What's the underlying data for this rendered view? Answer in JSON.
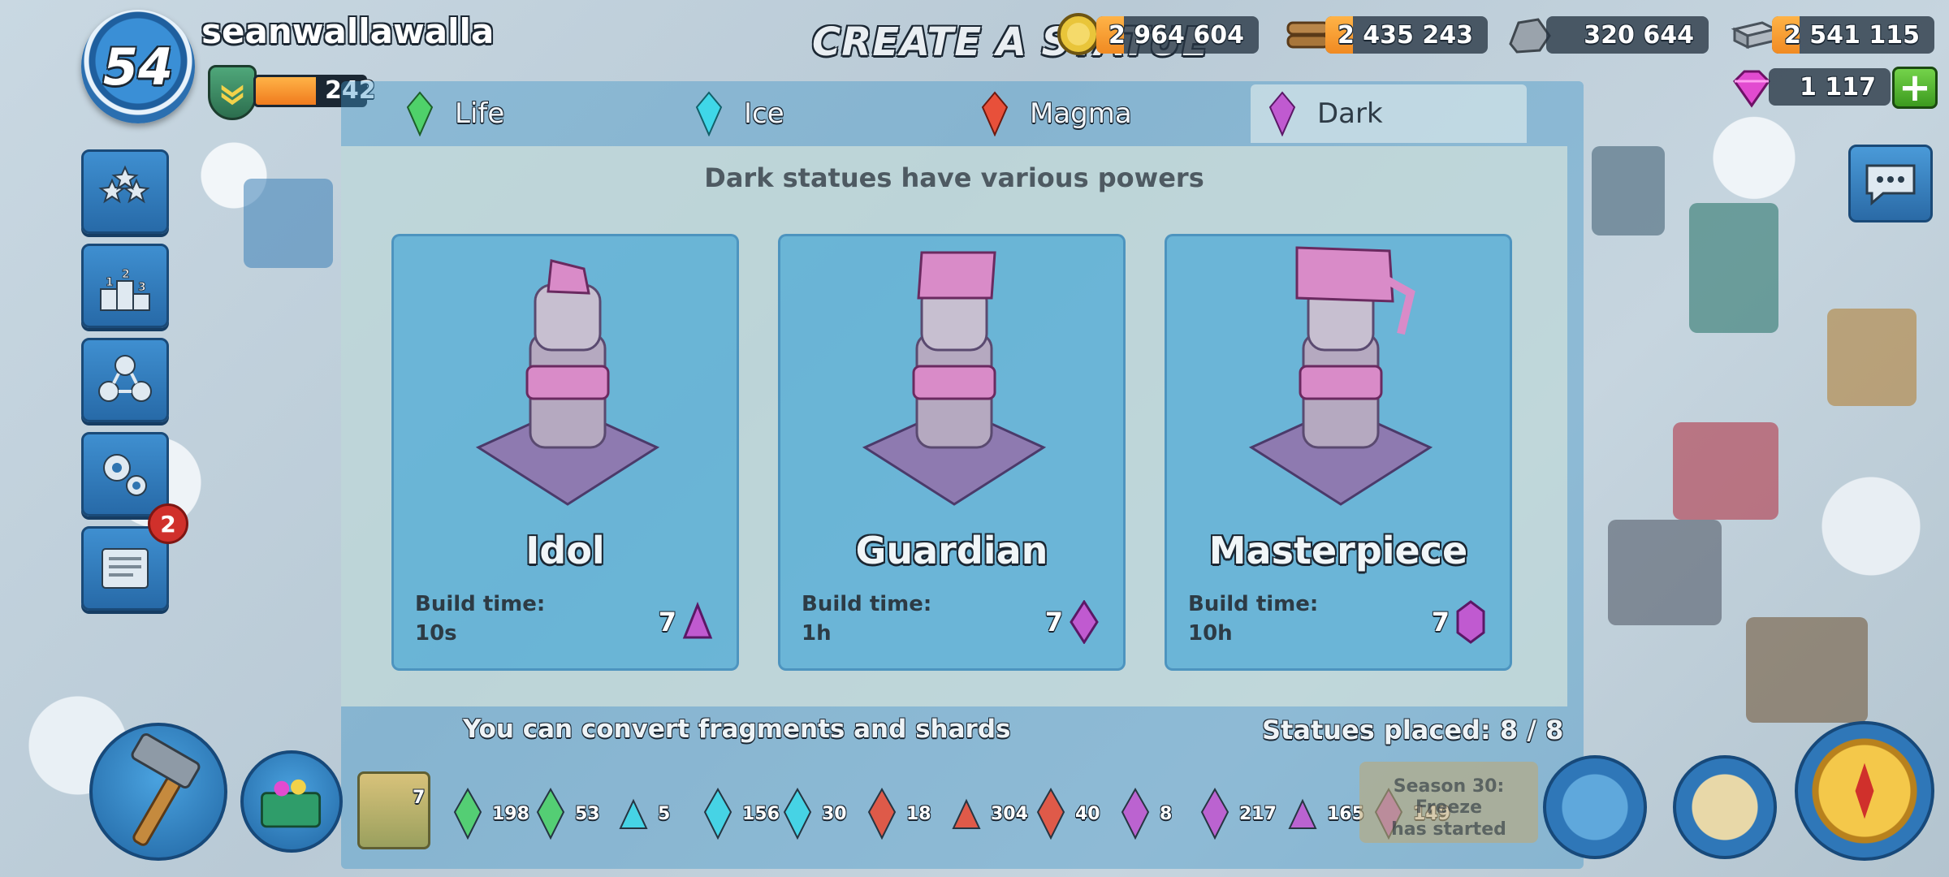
{
  "player": {
    "level": "54",
    "name": "seanwallawalla",
    "xp_value": "242",
    "xp_fraction": 0.55
  },
  "screen_title": "CREATE A STATUE",
  "resources": {
    "gold": "2 964 604",
    "wood": "2 435 243",
    "stone": "320 644",
    "iron": "2 541 115",
    "diamonds": "1 117"
  },
  "sidebar": {
    "items": [
      {
        "icon": "stars-icon"
      },
      {
        "icon": "leaderboard-icon"
      },
      {
        "icon": "task-force-icon"
      },
      {
        "icon": "settings-gears-icon"
      },
      {
        "icon": "newspaper-icon",
        "badge": "2"
      }
    ]
  },
  "tabs": [
    {
      "label": "Life",
      "color": "#4fd16a"
    },
    {
      "label": "Ice",
      "color": "#3fd7e8"
    },
    {
      "label": "Magma",
      "color": "#e8503a"
    },
    {
      "label": "Dark",
      "color": "#c05ad0",
      "active": true
    }
  ],
  "subtitle": "Dark statues have various powers",
  "cards": [
    {
      "name": "Idol",
      "build_label": "Build time:",
      "build_time": "10s",
      "cost": "7",
      "gem": "fragment"
    },
    {
      "name": "Guardian",
      "build_label": "Build time:",
      "build_time": "1h",
      "cost": "7",
      "gem": "shard"
    },
    {
      "name": "Masterpiece",
      "build_label": "Build time:",
      "build_time": "10h",
      "cost": "7",
      "gem": "crystal"
    }
  ],
  "footer": {
    "convert_text": "You can convert fragments and shards",
    "statues_placed": "Statues placed: 8 / 8"
  },
  "inventory": {
    "count": "7",
    "fragments": [
      {
        "value": "198",
        "color": "#4fd16a"
      },
      {
        "value": "53",
        "color": "#4fd16a"
      },
      {
        "value": "5",
        "color": "#3fd7e8"
      },
      {
        "value": "156",
        "color": "#3fd7e8"
      },
      {
        "value": "30",
        "color": "#3fd7e8"
      },
      {
        "value": "18",
        "color": "#e8503a"
      },
      {
        "value": "304",
        "color": "#e8503a"
      },
      {
        "value": "40",
        "color": "#e8503a"
      },
      {
        "value": "8",
        "color": "#c05ad0"
      },
      {
        "value": "217",
        "color": "#c05ad0"
      },
      {
        "value": "165",
        "color": "#c05ad0"
      },
      {
        "value": "149",
        "color": "#c05ad0"
      }
    ]
  },
  "season_banner": {
    "line1": "Season 30: Freeze",
    "line2": "has started"
  }
}
